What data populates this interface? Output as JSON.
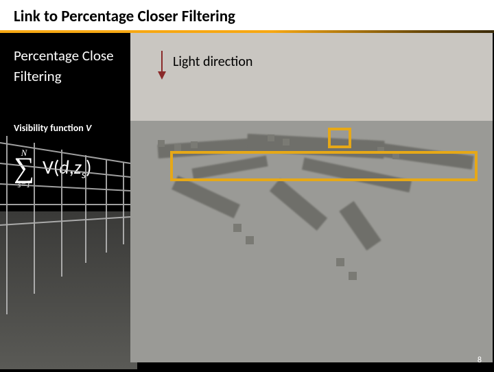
{
  "header": {
    "title": "Link to Percentage Closer Filtering"
  },
  "left": {
    "pcf_line1": "Percentage Close",
    "pcf_line2": "Filtering",
    "vfunc_prefix": "Visibility function ",
    "vfunc_sym": "V"
  },
  "sum": {
    "upper": "N",
    "lower": "s=1",
    "term_func": "V",
    "term_open": "(",
    "term_arg1": "d",
    "term_sep": ",",
    "term_arg2": "z",
    "term_sub": "s",
    "term_close": ")"
  },
  "scene": {
    "light_label": "Light direction"
  },
  "page": {
    "number": "8"
  }
}
